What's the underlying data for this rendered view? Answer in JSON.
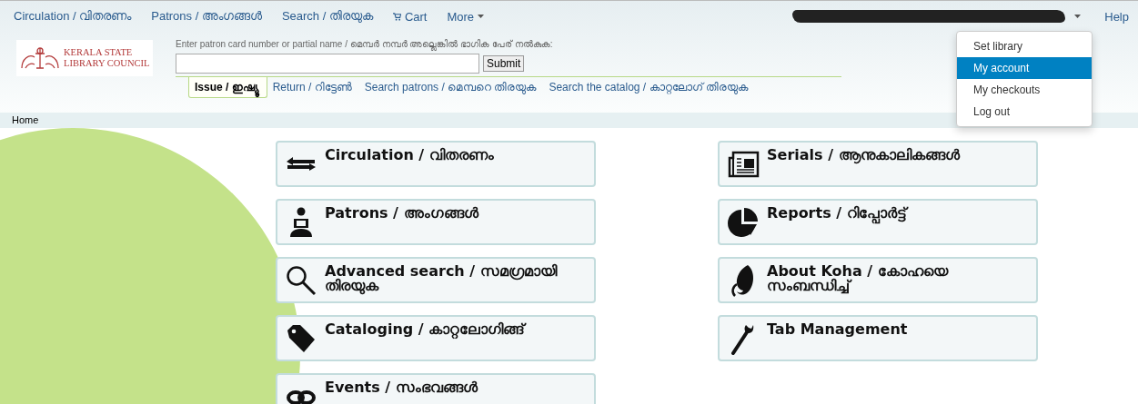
{
  "top_nav": [
    {
      "label": "Circulation / വിതരണം",
      "kind": "link"
    },
    {
      "label": "Patrons / അംഗങ്ങൾ",
      "kind": "link"
    },
    {
      "label": "Search / തിരയുക",
      "kind": "link"
    },
    {
      "label": "Cart",
      "kind": "cart"
    },
    {
      "label": "More",
      "kind": "dropdown"
    }
  ],
  "user_menu": {
    "expanded": true,
    "items": [
      {
        "label": "Set library",
        "selected": false
      },
      {
        "label": "My account",
        "selected": true
      },
      {
        "label": "My checkouts",
        "selected": false
      },
      {
        "label": "Log out",
        "selected": false
      }
    ]
  },
  "help": "Help",
  "logo": {
    "line1": "KERALA STATE",
    "line2": "LIBRARY COUNCIL"
  },
  "patron_search": {
    "label": "Enter patron card number or partial name / മെമ്പർ നമ്പർ അല്ലെങ്കിൽ ഭാഗിക പേര് നൽകുക:",
    "button": "Submit"
  },
  "search_tabs": [
    {
      "label": "Issue / ഇഷ്യൂ",
      "selected": true
    },
    {
      "label": "Return / റിട്ടേൺ",
      "selected": false
    },
    {
      "label": "Search patrons / മെമ്പറെ തിരയുക",
      "selected": false
    },
    {
      "label": "Search the catalog / കാറ്റലോഗ് തിരയുക",
      "selected": false
    }
  ],
  "breadcrumb": "Home",
  "module_columns": [
    [
      {
        "label": "Circulation / വിതരണം",
        "kind": "circulation"
      },
      {
        "label": "Patrons / അംഗങ്ങൾ",
        "kind": "patrons"
      },
      {
        "label": "Advanced search / സമഗ്രമായി തിരയുക",
        "kind": "search"
      },
      {
        "label": "Cataloging / കാറ്റലോഗിങ്ങ്",
        "kind": "cataloging"
      },
      {
        "label": "Events / സംഭവങ്ങൾ",
        "kind": "events"
      }
    ],
    [
      {
        "label": "Serials / ആനുകാലികങ്ങൾ",
        "kind": "serials"
      },
      {
        "label": "Reports / റിപ്പോർട്ട്",
        "kind": "reports"
      },
      {
        "label": "About Koha / കോഹയെ സംബന്ധിച്ച്",
        "kind": "about"
      },
      {
        "label": "Tab Management",
        "kind": "tools"
      }
    ]
  ]
}
